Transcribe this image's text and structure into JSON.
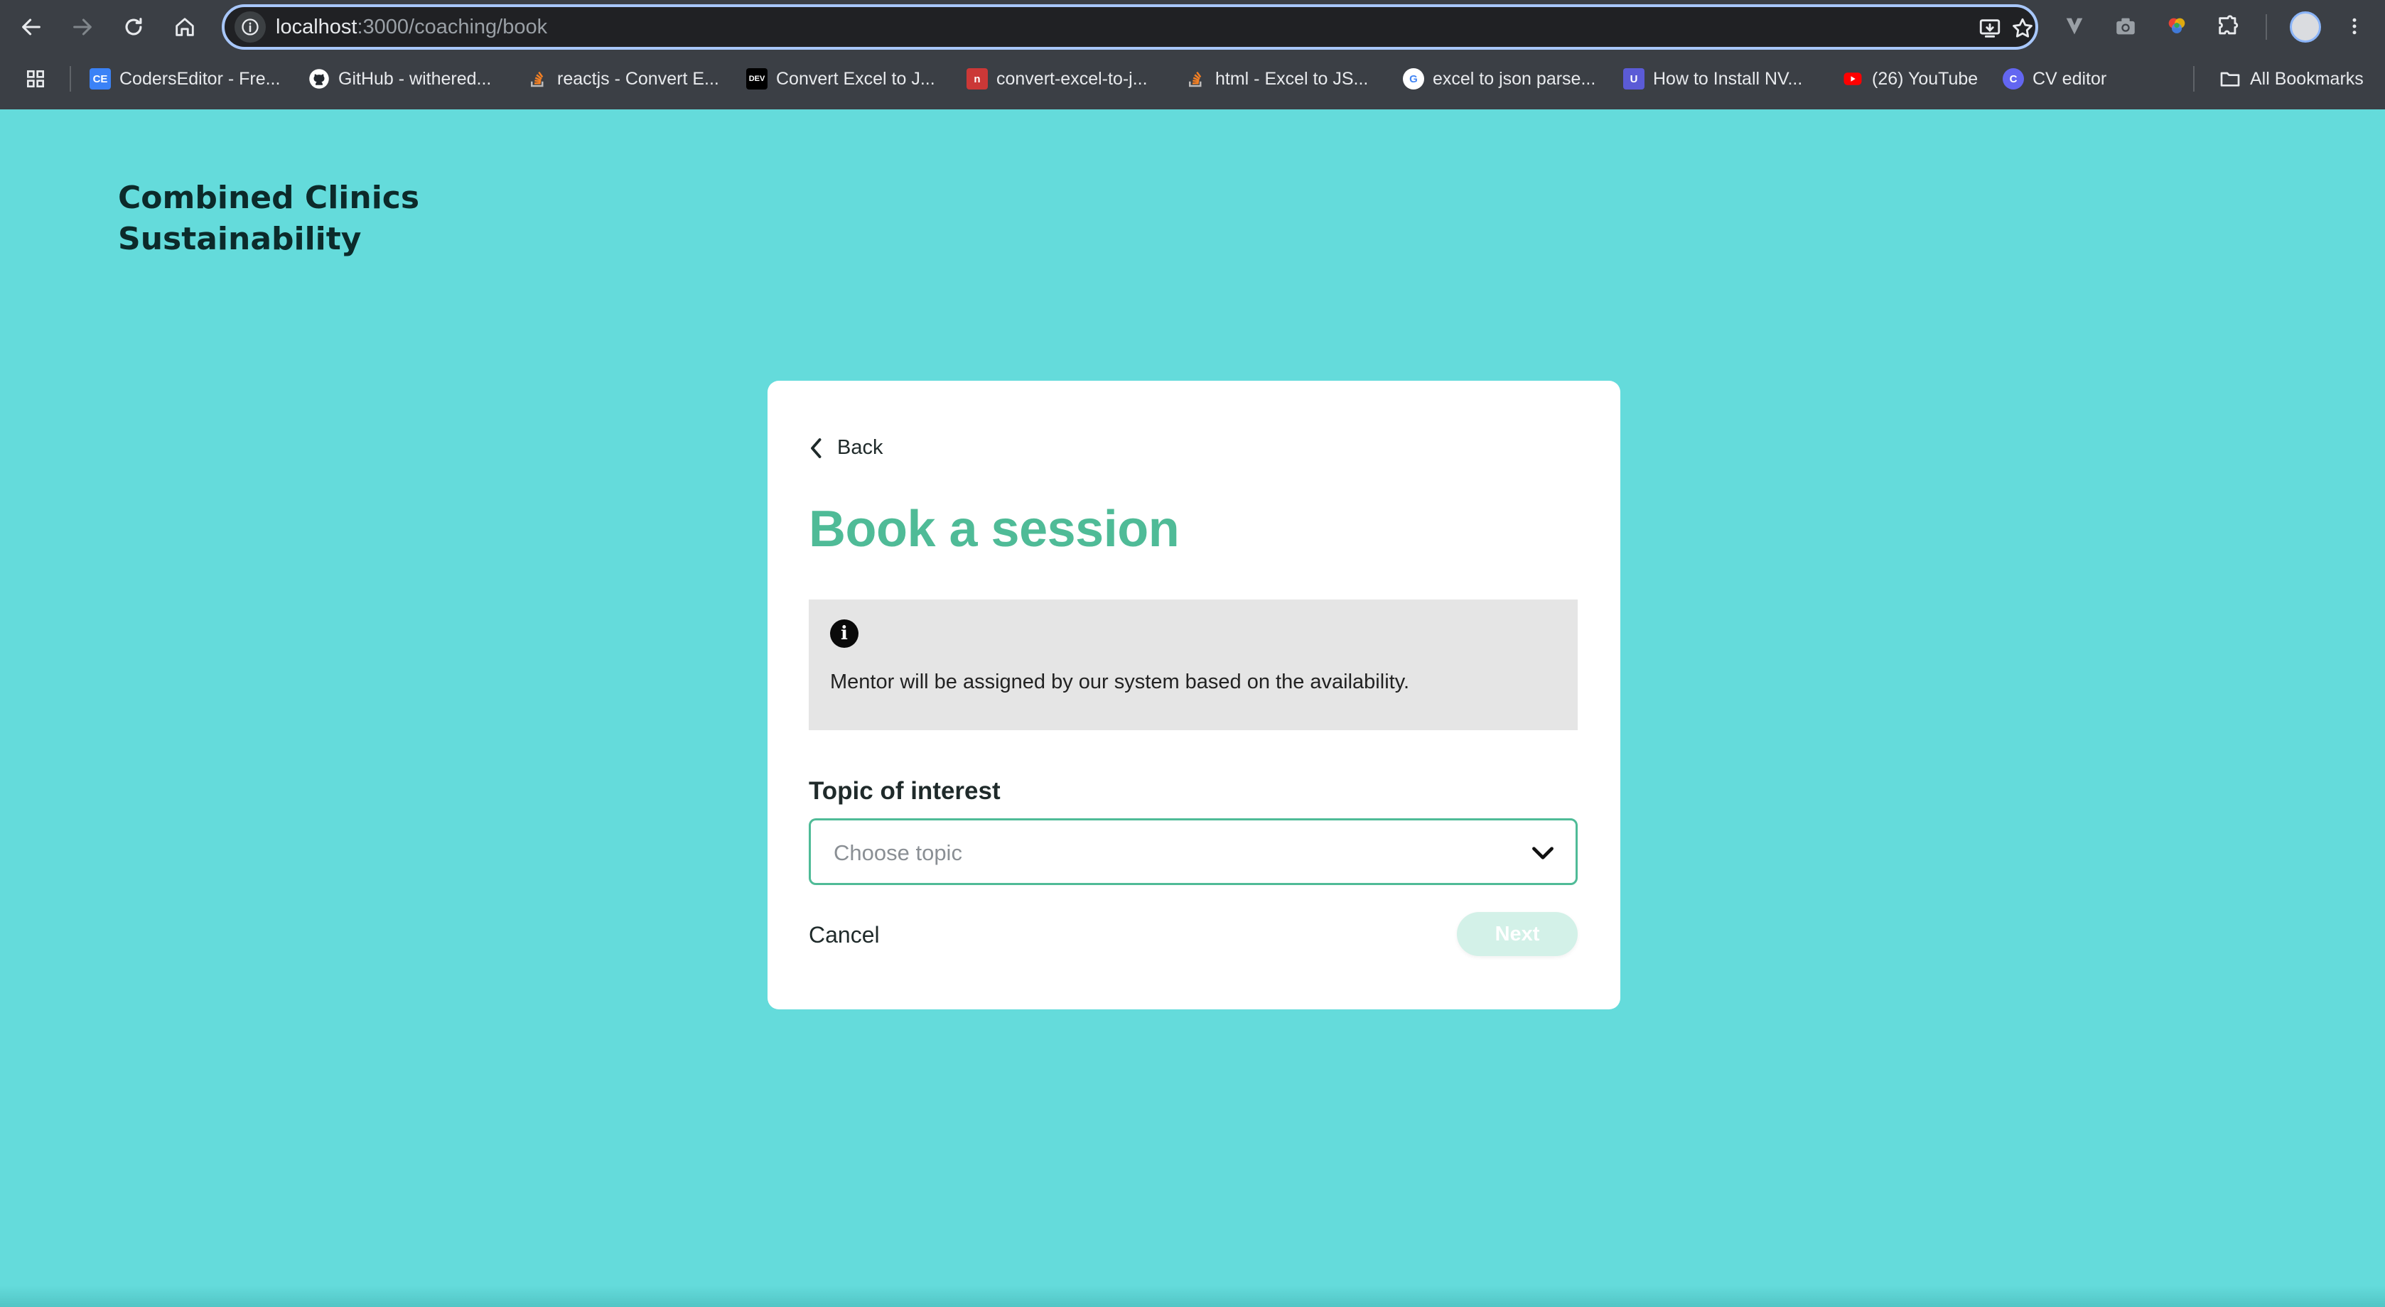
{
  "browser": {
    "url_host": "localhost",
    "url_path": ":3000/coaching/book",
    "bookmarks": [
      {
        "label": "CodersEditor - Fre...",
        "icon": "codersditor-favicon",
        "badge": "CE",
        "color": "#3b82f6"
      },
      {
        "label": "GitHub - withered...",
        "icon": "github-icon",
        "badge": "",
        "color": "#ffffff"
      },
      {
        "label": "reactjs - Convert E...",
        "icon": "stackoverflow-icon",
        "badge": "",
        "color": "#f48024"
      },
      {
        "label": "Convert Excel to J...",
        "icon": "dev-icon",
        "badge": "DEV",
        "color": "#000000"
      },
      {
        "label": "convert-excel-to-j...",
        "icon": "npm-icon",
        "badge": "n",
        "color": "#cb3837"
      },
      {
        "label": "html - Excel to JS...",
        "icon": "stackoverflow-icon",
        "badge": "",
        "color": "#f48024"
      },
      {
        "label": "excel to json parse...",
        "icon": "google-icon",
        "badge": "G",
        "color": "#ffffff"
      },
      {
        "label": "How to Install NV...",
        "icon": "udemy-icon",
        "badge": "U",
        "color": "#5b5bd6"
      },
      {
        "label": "(26) YouTube",
        "icon": "youtube-icon",
        "badge": "",
        "color": "#ff0000"
      },
      {
        "label": "CV editor",
        "icon": "cv-editor-icon",
        "badge": "C",
        "color": "#6366f1"
      }
    ],
    "all_bookmarks_label": "All Bookmarks"
  },
  "page": {
    "brand": "Combined Clinics Sustainability",
    "back_label": "Back",
    "title": "Book a session",
    "info_text": "Mentor will be assigned by our system based on the availability.",
    "topic_label": "Topic of interest",
    "topic_placeholder": "Choose topic",
    "cancel_label": "Cancel",
    "next_label": "Next"
  },
  "colors": {
    "background": "#64dbdb",
    "accent": "#4fbb97",
    "next_disabled": "#d3f1e8"
  }
}
